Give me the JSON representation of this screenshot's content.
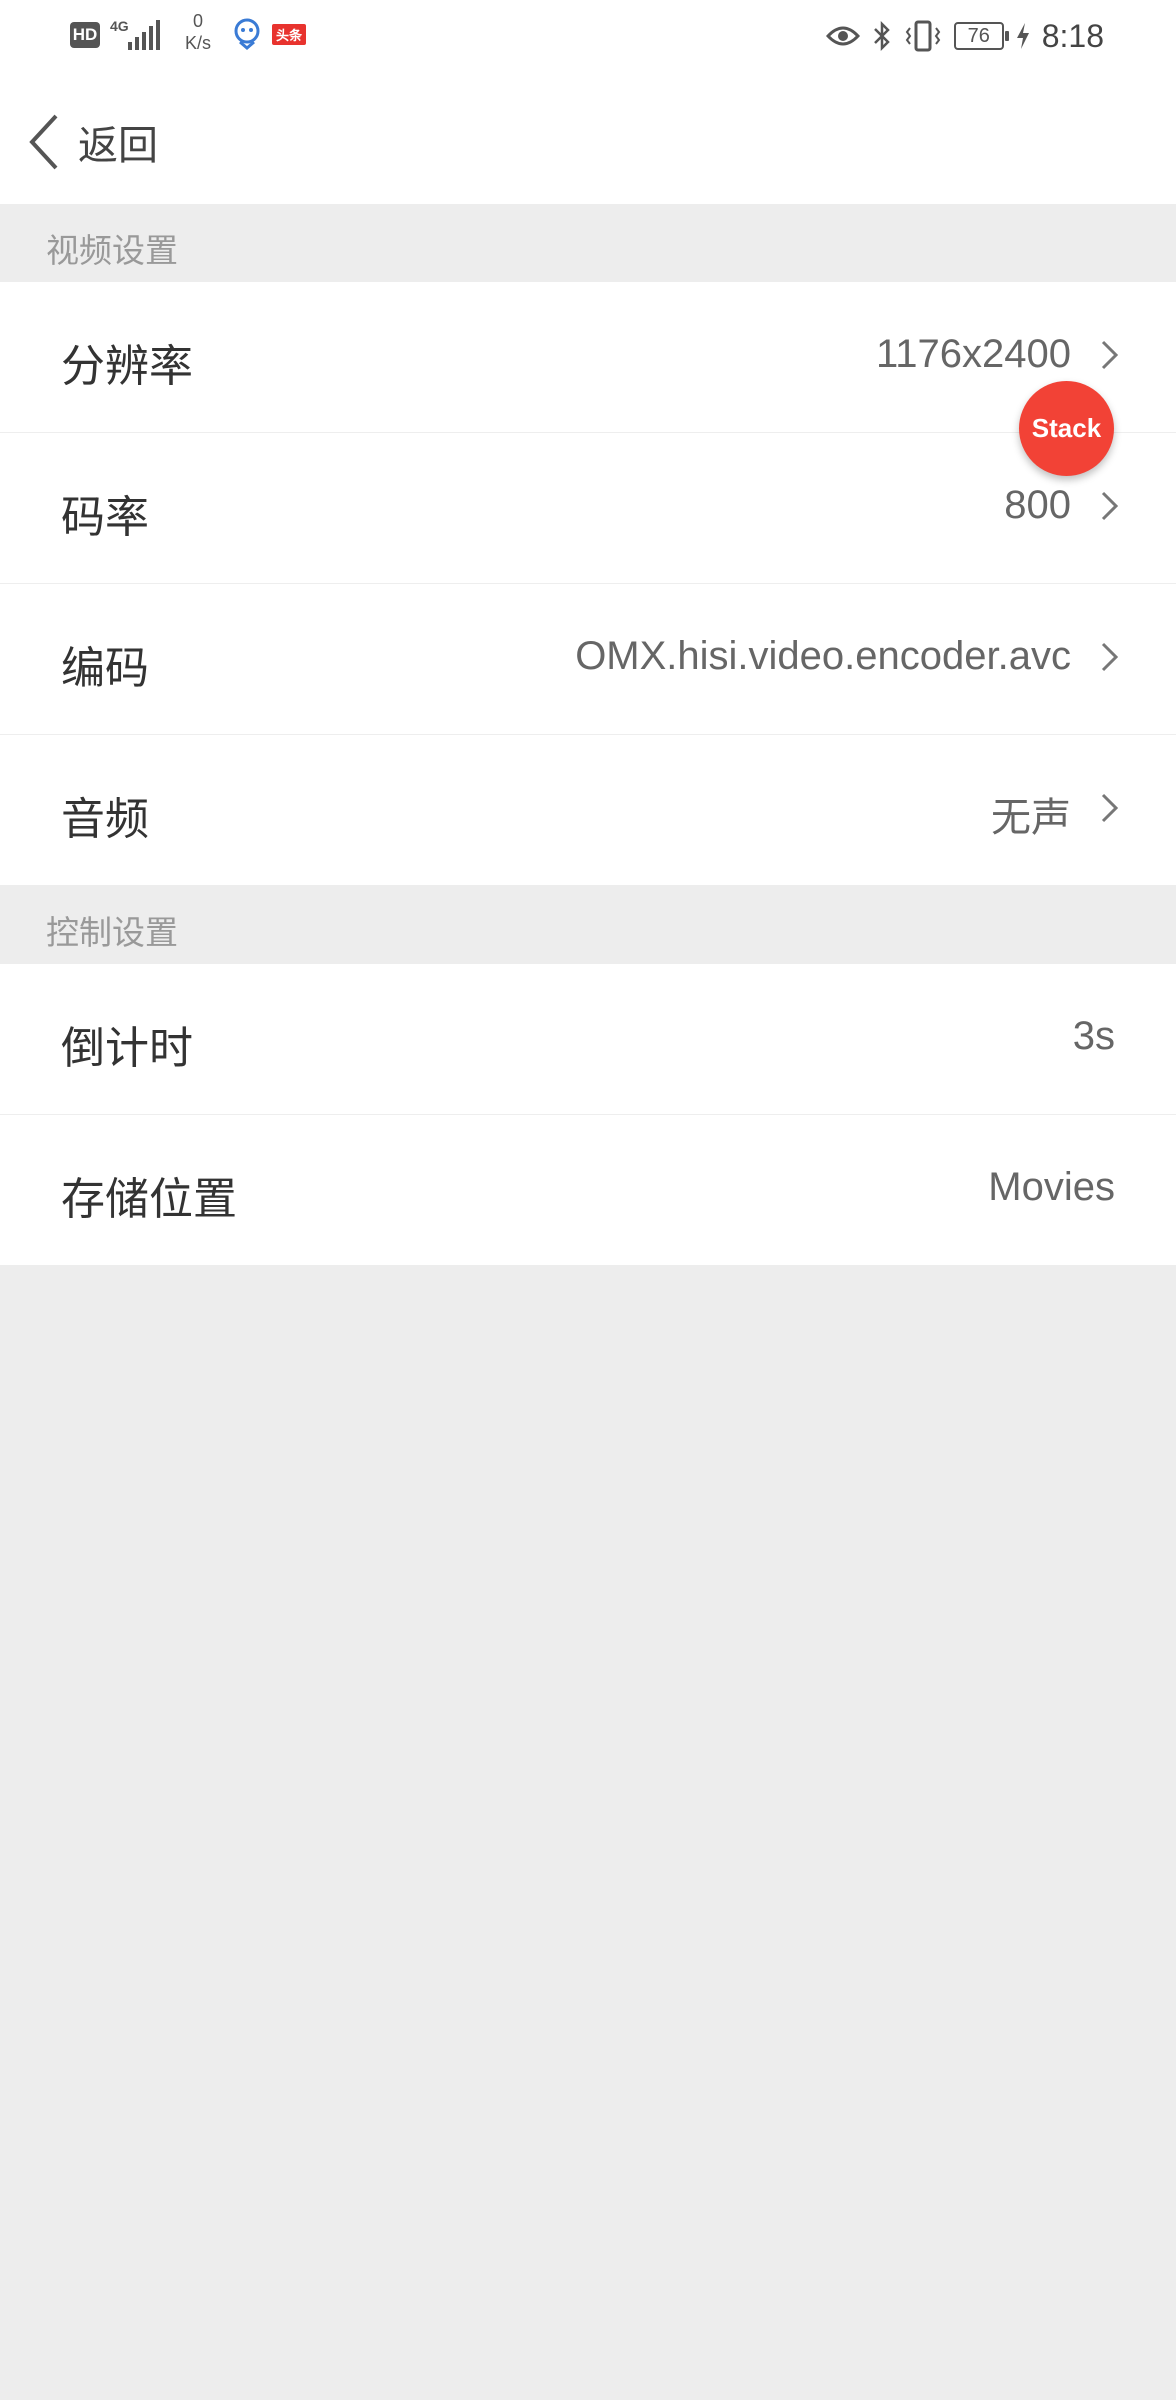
{
  "status_bar": {
    "hd": "HD",
    "network": "4G",
    "speed_value": "0",
    "speed_unit": "K/s",
    "app_badge": "头条",
    "battery": "76",
    "time": "8:18"
  },
  "nav": {
    "back_label": "返回"
  },
  "sections": {
    "video": {
      "title": "视频设置",
      "rows": [
        {
          "label": "分辨率",
          "value": "1176x2400"
        },
        {
          "label": "码率",
          "value": "800"
        },
        {
          "label": "编码",
          "value": "OMX.hisi.video.encoder.avc"
        },
        {
          "label": "音频",
          "value": "无声"
        }
      ]
    },
    "control": {
      "title": "控制设置",
      "rows": [
        {
          "label": "倒计时",
          "value": "3s"
        },
        {
          "label": "存储位置",
          "value": "Movies"
        }
      ]
    }
  },
  "fab": {
    "label": "Stack"
  },
  "colors": {
    "accent": "#f24236",
    "background": "#ededed",
    "section_text": "#999999"
  }
}
